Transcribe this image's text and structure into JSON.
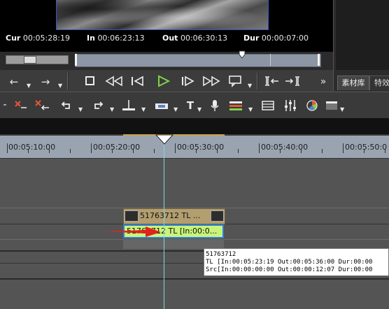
{
  "timecodes": {
    "cur_label": "Cur",
    "cur_value": "00:05:28:19",
    "in_label": "In",
    "in_value": "00:06:23:13",
    "out_label": "Out",
    "out_value": "00:06:30:13",
    "dur_label": "Dur",
    "dur_value": "00:00:07:00"
  },
  "panel_tabs": [
    "素材库",
    "特效"
  ],
  "transport": {
    "set_in": "Set In",
    "set_out": "Set Out",
    "stop": "Stop",
    "rewind": "Rewind",
    "step_back": "Step back",
    "play": "Play",
    "step_forward": "Step forward",
    "fast_forward": "Fast forward",
    "loop": "Loop",
    "insert": "Insert",
    "overwrite": "Overwrite",
    "more": "More"
  },
  "ruler": {
    "labels": [
      "00:05:10:00",
      "00:05:20:00",
      "00:05:30:00",
      "00:05:40:00",
      "00:05:50:0"
    ]
  },
  "clips": {
    "top_label": "51763712  TL ...",
    "bottom_label": "51763712  TL [In:00:0..."
  },
  "tooltip": {
    "line1": "51763712",
    "line2": "TL [In:00:05:23:19 Out:00:05:36:00 Dur:00:00",
    "line3": "Src[In:00:00:00:00 Out:00:00:12:07 Dur:00:00"
  },
  "colors": {
    "clip_video": "#b39e70",
    "clip_audio": "#c9f47a",
    "clip_selected_border": "#2f7fd8",
    "playhead": "#7fd6e0",
    "play_button": "#7fd24a",
    "annotation_arrow": "#e0231e"
  }
}
